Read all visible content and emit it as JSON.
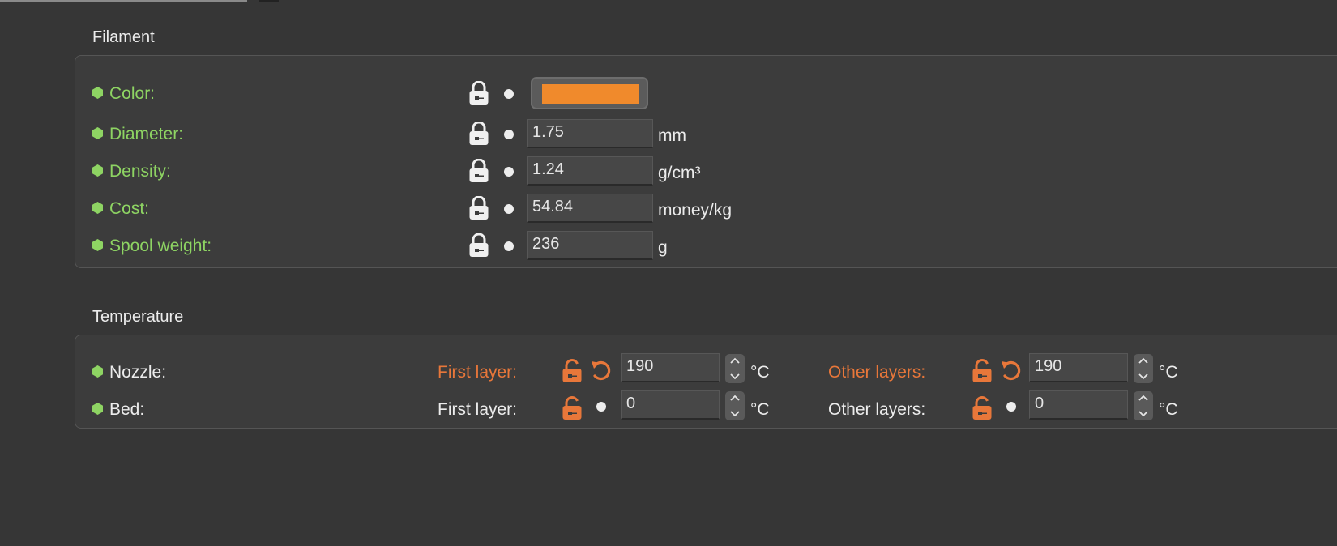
{
  "colors": {
    "green_label": "#8ed463",
    "orange": "#e8773a",
    "filament_color": "#f08a2c"
  },
  "filament": {
    "title": "Filament",
    "color_label": "Color:",
    "diameter": {
      "label": "Diameter:",
      "value": "1.75",
      "unit": "mm"
    },
    "density": {
      "label": "Density:",
      "value": "1.24",
      "unit": "g/cm³"
    },
    "cost": {
      "label": "Cost:",
      "value": "54.84",
      "unit": "money/kg"
    },
    "spool_weight": {
      "label": "Spool weight:",
      "value": "236",
      "unit": "g"
    }
  },
  "temperature": {
    "title": "Temperature",
    "nozzle": {
      "label": "Nozzle:",
      "first_layer_label": "First layer:",
      "first_layer_value": "190",
      "other_layers_label": "Other layers:",
      "other_layers_value": "190",
      "unit": "°C"
    },
    "bed": {
      "label": "Bed:",
      "first_layer_label": "First layer:",
      "first_layer_value": "0",
      "other_layers_label": "Other layers:",
      "other_layers_value": "0",
      "unit": "°C"
    }
  }
}
